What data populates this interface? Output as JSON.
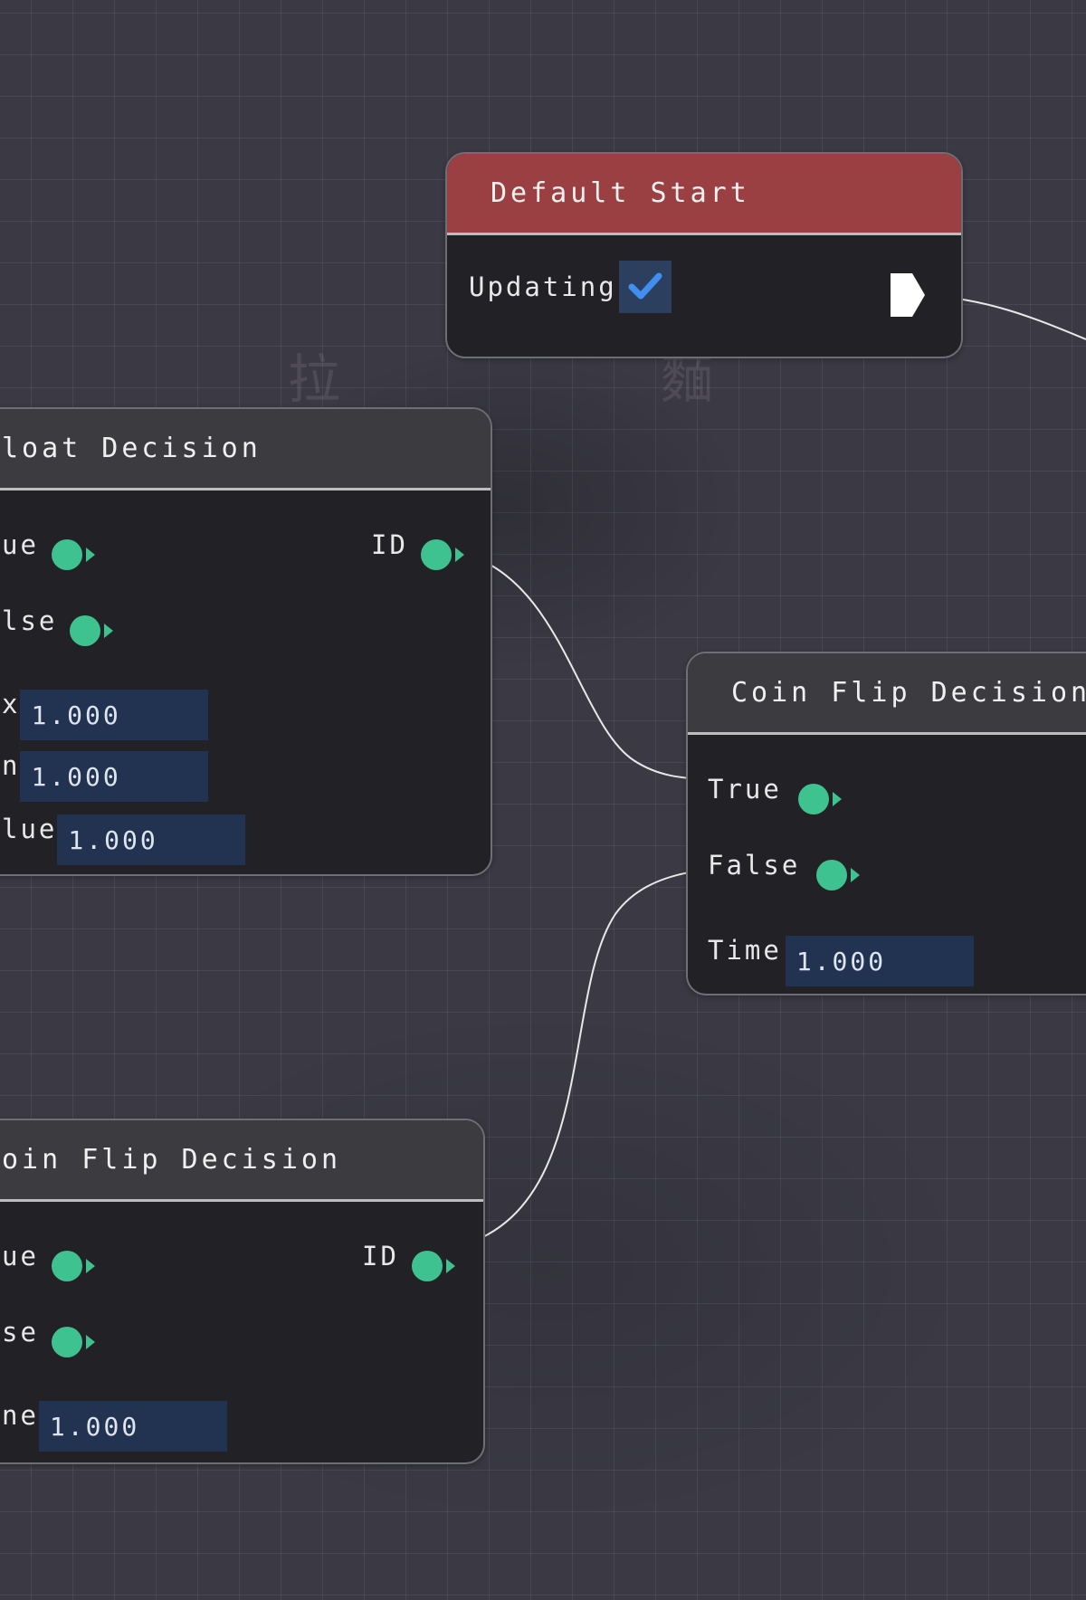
{
  "nodes": {
    "default_start": {
      "title": "Default Start",
      "updating_label": "Updating",
      "updating_checked": true,
      "header_color": "#9a4043"
    },
    "float_decision": {
      "title": "loat Decision",
      "pin_true": "ue",
      "pin_false": "lse",
      "pin_id": "ID",
      "field1_label": "x",
      "field1_value": "1.000",
      "field2_label": "n",
      "field2_value": "1.000",
      "field3_label": "lue",
      "field3_value": "1.000"
    },
    "coin_flip_right": {
      "title": "Coin Flip Decision",
      "pin_true": "True",
      "pin_false": "False",
      "time_label": "Time",
      "time_value": "1.000"
    },
    "coin_flip_bottom": {
      "title": "oin Flip Decision",
      "pin_true": "ue",
      "pin_false": "se",
      "pin_id": "ID",
      "time_label": "ne",
      "time_value": "1.000"
    }
  },
  "colors": {
    "pin": "#3ec390",
    "field_bg": "#213351",
    "check": "#3f8ef0",
    "wire": "#e8e8e8"
  },
  "icons": {
    "checkbox": "checkmark-icon",
    "exec_output": "exec-pin-icon",
    "pins": "dot-arrow-pin-icon"
  }
}
